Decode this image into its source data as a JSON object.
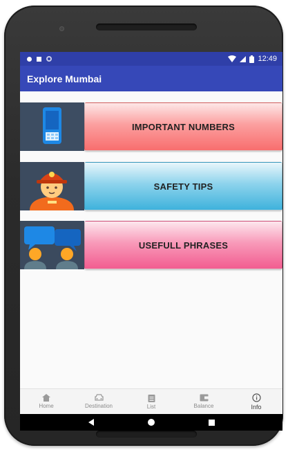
{
  "status_bar": {
    "time": "12:49"
  },
  "app_bar": {
    "title": "Explore Mumbai"
  },
  "cards": [
    {
      "label": "IMPORTANT NUMBERS",
      "icon": "phone-icon",
      "color": "#f86e6e"
    },
    {
      "label": "SAFETY TIPS",
      "icon": "firefighter-icon",
      "color": "#3fb2dc"
    },
    {
      "label": "USEFULL PHRASES",
      "icon": "chat-people-icon",
      "color": "#f25d90"
    }
  ],
  "bottom_nav": {
    "items": [
      {
        "label": "Home",
        "icon": "home-icon",
        "active": false
      },
      {
        "label": "Destination",
        "icon": "car-icon",
        "active": false
      },
      {
        "label": "List",
        "icon": "clipboard-icon",
        "active": false
      },
      {
        "label": "Balance",
        "icon": "wallet-icon",
        "active": false
      },
      {
        "label": "Info",
        "icon": "info-icon",
        "active": true
      }
    ]
  },
  "colors": {
    "primary": "#3648b8",
    "primary_dark": "#2f3fa8"
  }
}
